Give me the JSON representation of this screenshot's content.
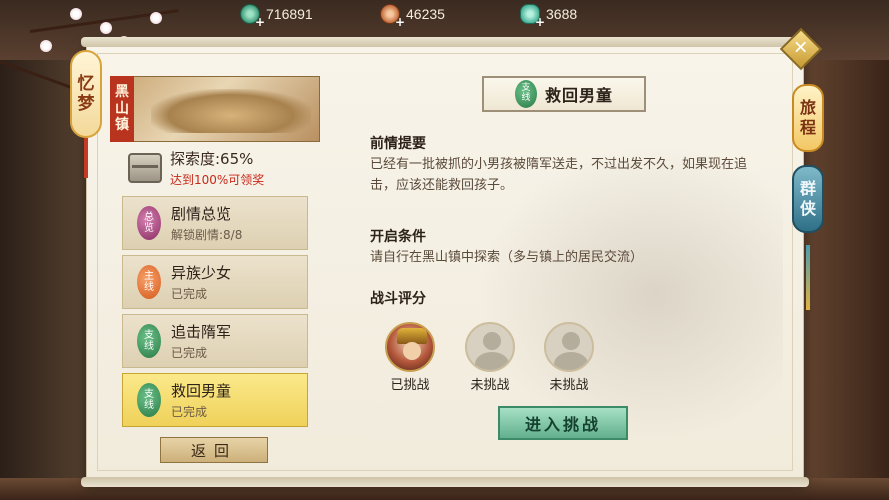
{
  "currency": {
    "jade_coin": "716891",
    "copper_coin": "46235",
    "jade_token": "3688"
  },
  "tabs": {
    "memory": [
      "忆",
      "梦"
    ],
    "travel": [
      "旅",
      "程"
    ],
    "heroes": [
      "群",
      "侠"
    ]
  },
  "region": {
    "name": [
      "黑",
      "山",
      "镇"
    ],
    "explore_label": "探索度:65%",
    "explore_reward": "达到100%可领奖"
  },
  "menu": [
    {
      "badge": [
        "总",
        "览"
      ],
      "title": "剧情总览",
      "status": "解锁剧情:8/8"
    },
    {
      "badge": [
        "主",
        "线"
      ],
      "title": "异族少女",
      "status": "已完成"
    },
    {
      "badge": [
        "支",
        "线"
      ],
      "title": "追击隋军",
      "status": "已完成"
    },
    {
      "badge": [
        "支",
        "线"
      ],
      "title": "救回男童",
      "status": "已完成"
    }
  ],
  "back_label": "返回",
  "quest": {
    "badge": [
      "支",
      "线"
    ],
    "title": "救回男童",
    "prologue_heading": "前情提要",
    "prologue_text": "已经有一批被抓的小男孩被隋军送走，不过出发不久，如果现在追击，应该还能救回孩子。",
    "condition_heading": "开启条件",
    "condition_text": "请自行在黑山镇中探索（多与镇上的居民交流）",
    "rating_heading": "战斗评分",
    "challengers": [
      {
        "status": "已挑战"
      },
      {
        "status": "未挑战"
      },
      {
        "status": "未挑战"
      }
    ],
    "enter_label": "进入挑战"
  },
  "close_icon": "close-icon",
  "colors": {
    "active_item": "#efd15a",
    "enter_button": "#62b08d",
    "reward_text": "#c8281a"
  }
}
